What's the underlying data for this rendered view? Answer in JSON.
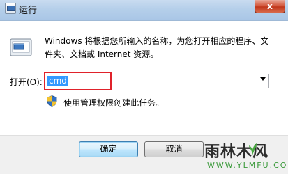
{
  "window": {
    "title": "运行",
    "close_label": "x"
  },
  "dialog": {
    "description": "Windows 将根据您所输入的名称，为您打开相应的程序、文件夹、文档或 Internet 资源。",
    "open_label": "打开(O):",
    "open_value": "cmd",
    "admin_note": "使用管理权限创建此任务。"
  },
  "buttons": {
    "ok": "确定",
    "cancel": "取消"
  },
  "icons": {
    "window_icon": "run-icon",
    "dialog_icon": "run-program-icon",
    "shield": "uac-shield-icon",
    "dropdown": "chevron-down-icon"
  },
  "watermark": {
    "text": "雨林木风",
    "url": "WWW.YLMFU.COM"
  },
  "colors": {
    "selection": "#3399ff",
    "highlight_box": "#e0222b",
    "close_button": "#c0361a"
  }
}
